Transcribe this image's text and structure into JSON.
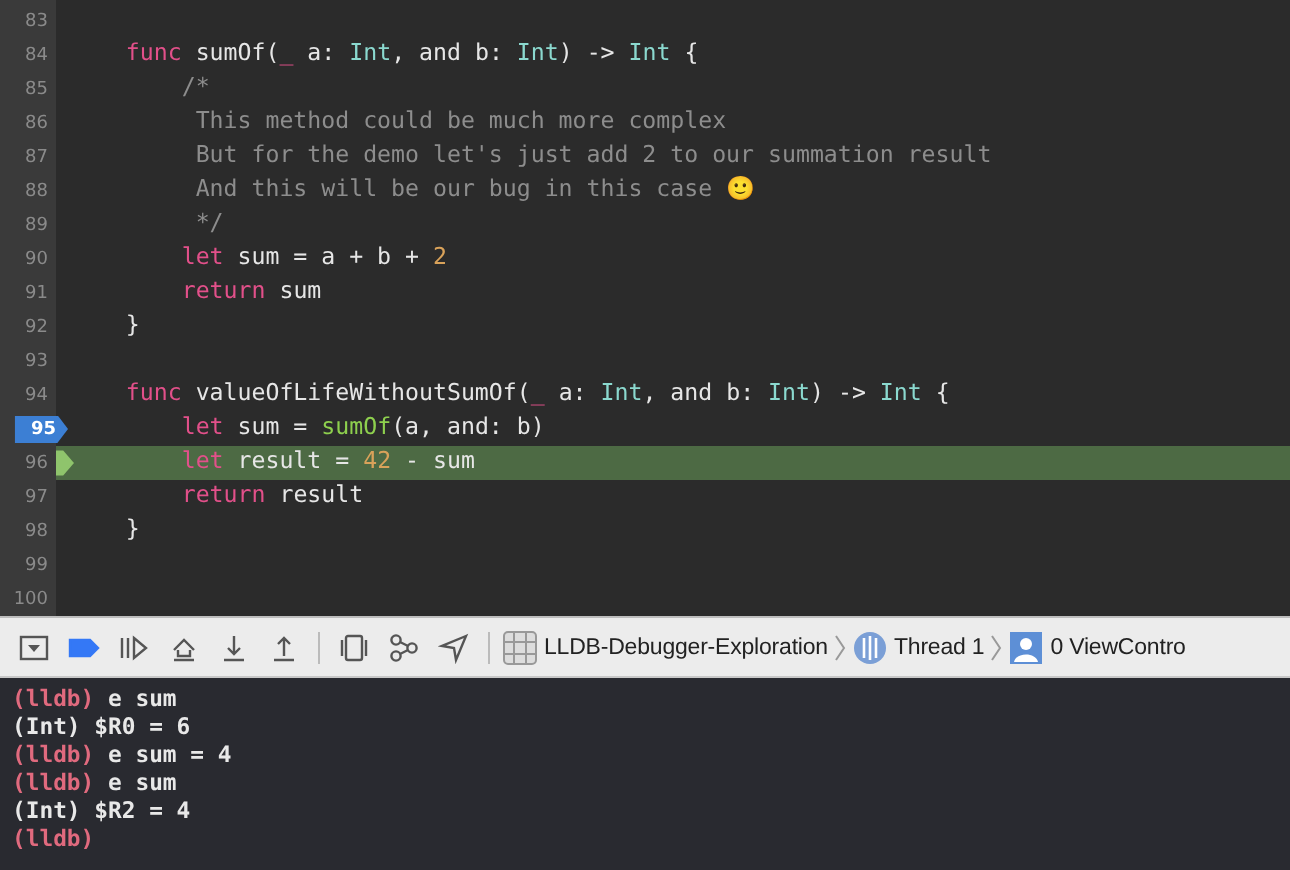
{
  "editor": {
    "lines": [
      {
        "number": "83"
      },
      {
        "number": "84",
        "tokens": [
          {
            "text": "    func",
            "kind": "keyword"
          },
          {
            "text": " sumOf(",
            "kind": "plain"
          },
          {
            "text": "_",
            "kind": "keyword"
          },
          {
            "text": " a: ",
            "kind": "plain"
          },
          {
            "text": "Int",
            "kind": "type"
          },
          {
            "text": ", and b: ",
            "kind": "plain"
          },
          {
            "text": "Int",
            "kind": "type"
          },
          {
            "text": ") -> ",
            "kind": "plain"
          },
          {
            "text": "Int",
            "kind": "type"
          },
          {
            "text": " {",
            "kind": "plain"
          }
        ]
      },
      {
        "number": "85",
        "tokens": [
          {
            "text": "        /*",
            "kind": "comment"
          }
        ]
      },
      {
        "number": "86",
        "tokens": [
          {
            "text": "         This method could be much more complex",
            "kind": "comment"
          }
        ]
      },
      {
        "number": "87",
        "tokens": [
          {
            "text": "         But for the demo let's just add 2 to our summation result",
            "kind": "comment"
          }
        ]
      },
      {
        "number": "88",
        "tokens": [
          {
            "text": "         And this will be our bug in this case 🙂",
            "kind": "comment"
          }
        ]
      },
      {
        "number": "89",
        "tokens": [
          {
            "text": "         */",
            "kind": "comment"
          }
        ]
      },
      {
        "number": "90",
        "tokens": [
          {
            "text": "        let",
            "kind": "keyword"
          },
          {
            "text": " sum = a + b + ",
            "kind": "plain"
          },
          {
            "text": "2",
            "kind": "number"
          }
        ]
      },
      {
        "number": "91",
        "tokens": [
          {
            "text": "        return",
            "kind": "keyword"
          },
          {
            "text": " sum",
            "kind": "plain"
          }
        ]
      },
      {
        "number": "92",
        "tokens": [
          {
            "text": "    }",
            "kind": "plain"
          }
        ]
      },
      {
        "number": "93"
      },
      {
        "number": "94",
        "tokens": [
          {
            "text": "    func",
            "kind": "keyword"
          },
          {
            "text": " valueOfLifeWithoutSumOf(",
            "kind": "plain"
          },
          {
            "text": "_",
            "kind": "keyword"
          },
          {
            "text": " a: ",
            "kind": "plain"
          },
          {
            "text": "Int",
            "kind": "type"
          },
          {
            "text": ", and b: ",
            "kind": "plain"
          },
          {
            "text": "Int",
            "kind": "type"
          },
          {
            "text": ") -> ",
            "kind": "plain"
          },
          {
            "text": "Int",
            "kind": "type"
          },
          {
            "text": " {",
            "kind": "plain"
          }
        ]
      },
      {
        "number": "95",
        "breakpoint": true,
        "tokens": [
          {
            "text": "        let",
            "kind": "keyword"
          },
          {
            "text": " sum = ",
            "kind": "plain"
          },
          {
            "text": "sumOf",
            "kind": "call"
          },
          {
            "text": "(a, and: b)",
            "kind": "plain"
          }
        ]
      },
      {
        "number": "96",
        "current": true,
        "tokens": [
          {
            "text": "        let",
            "kind": "keyword"
          },
          {
            "text": " result = ",
            "kind": "plain"
          },
          {
            "text": "42",
            "kind": "number"
          },
          {
            "text": " - sum",
            "kind": "plain"
          }
        ]
      },
      {
        "number": "97",
        "tokens": [
          {
            "text": "        return",
            "kind": "keyword"
          },
          {
            "text": " result",
            "kind": "plain"
          }
        ]
      },
      {
        "number": "98",
        "tokens": [
          {
            "text": "    }",
            "kind": "plain"
          }
        ]
      },
      {
        "number": "99"
      },
      {
        "number": "100"
      }
    ]
  },
  "debug_bar": {
    "buttons": [
      {
        "kind": "hide-panel"
      },
      {
        "kind": "breakpoints",
        "on": true
      },
      {
        "kind": "continue"
      },
      {
        "kind": "step-over"
      },
      {
        "kind": "step-into"
      },
      {
        "kind": "step-out"
      },
      {
        "kind": "view-debugger"
      },
      {
        "kind": "memory-graph"
      },
      {
        "kind": "location"
      }
    ],
    "jump_bar": [
      {
        "kind": "project",
        "label": "LLDB-Debugger-Exploration"
      },
      {
        "kind": "thread",
        "label": "Thread 1"
      },
      {
        "kind": "frame",
        "label": "0 ViewContro"
      }
    ]
  },
  "console": {
    "lines": [
      {
        "kind": "input",
        "prompt": "(lldb)",
        "command": "e sum"
      },
      {
        "kind": "output",
        "text": "(Int) $R0 = 6"
      },
      {
        "kind": "input",
        "prompt": "(lldb)",
        "command": "e sum = 4"
      },
      {
        "kind": "input",
        "prompt": "(lldb)",
        "command": "e sum"
      },
      {
        "kind": "output",
        "text": "(Int) $R2 = 4"
      },
      {
        "kind": "input",
        "prompt": "(lldb)"
      }
    ]
  }
}
